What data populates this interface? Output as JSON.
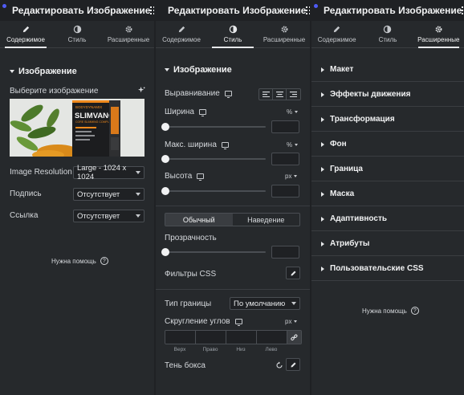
{
  "header": {
    "title": "Редактировать Изображение"
  },
  "tabs": {
    "content": "Содержимое",
    "style": "Стиль",
    "advanced": "Расширенные"
  },
  "content": {
    "section_title": "Изображение",
    "choose_image": "Выберите изображение",
    "product_brand": "BODYDYNAMIX",
    "product_name": "SLIMVANCE",
    "product_sub": "CORE SLIMMING COMPLEX",
    "resolution_label": "Image Resolution",
    "resolution_value": "Large - 1024 x 1024",
    "caption_label": "Подпись",
    "caption_value": "Отсутствует",
    "link_label": "Ссылка",
    "link_value": "Отсутствует",
    "help": "Нужна помощь"
  },
  "style": {
    "section_title": "Изображение",
    "alignment_label": "Выравнивание",
    "width_label": "Ширина",
    "width_unit": "%",
    "max_width_label": "Макс. ширина",
    "max_width_unit": "%",
    "height_label": "Высота",
    "height_unit": "px",
    "state_normal": "Обычный",
    "state_hover": "Наведение",
    "opacity_label": "Прозрачность",
    "css_filters_label": "Фильтры CSS",
    "border_type_label": "Тип границы",
    "border_type_value": "По умолчанию",
    "radius_label": "Скругление углов",
    "radius_unit": "px",
    "dim_top": "Верх",
    "dim_right": "Право",
    "dim_bottom": "Низ",
    "dim_left": "Лево",
    "box_shadow_label": "Тень бокса"
  },
  "advanced": {
    "items": [
      "Макет",
      "Эффекты движения",
      "Трансформация",
      "Фон",
      "Граница",
      "Маска",
      "Адаптивность",
      "Атрибуты",
      "Пользовательские CSS"
    ],
    "help": "Нужна помощь"
  }
}
